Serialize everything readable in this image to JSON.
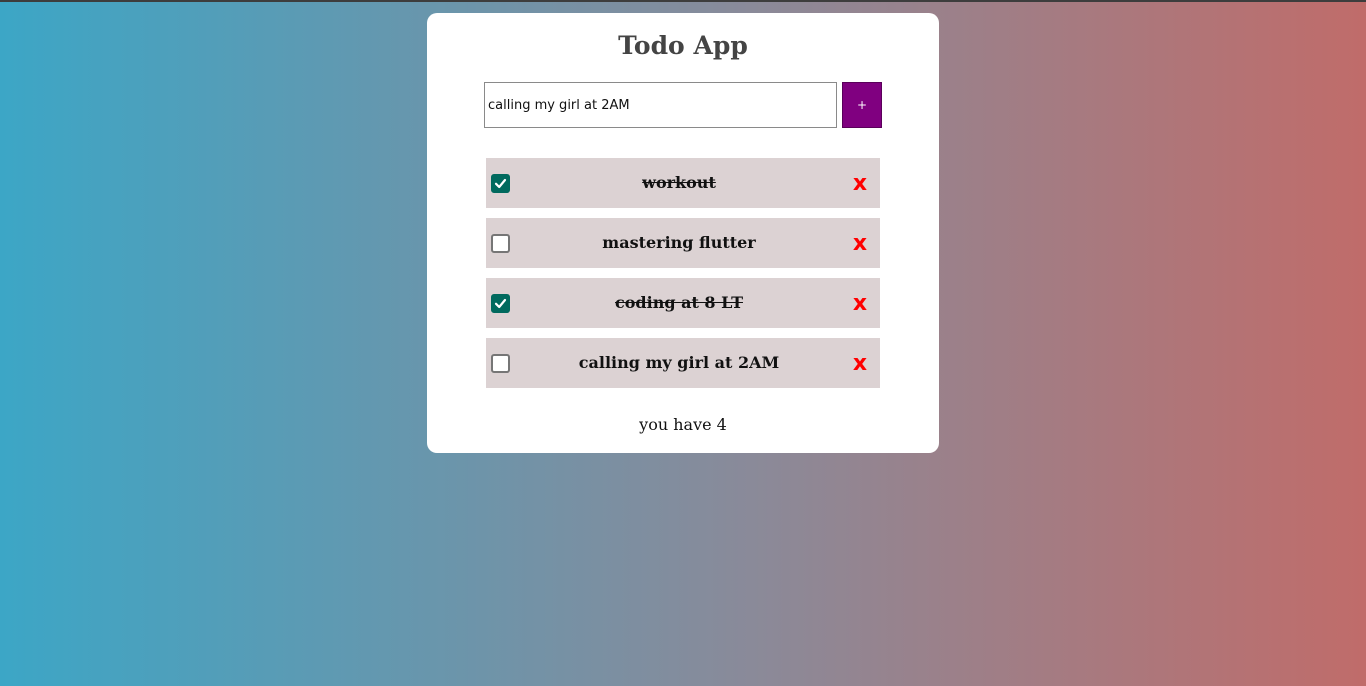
{
  "app": {
    "title": "Todo App"
  },
  "input": {
    "value": "calling my girl at 2AM",
    "placeholder": ""
  },
  "add_button": {
    "label": "+"
  },
  "todos": [
    {
      "text": "workout",
      "done": true
    },
    {
      "text": "mastering flutter",
      "done": false
    },
    {
      "text": "coding at 8 LT",
      "done": true
    },
    {
      "text": "calling my girl at 2AM",
      "done": false
    }
  ],
  "delete_label": "x",
  "footer": {
    "count_text": "you have 4"
  },
  "colors": {
    "gradient_left": "#3ca6c6",
    "gradient_right": "#c06c6a",
    "add_button": "#800080",
    "item_background": "#dcd2d3",
    "checkbox_checked": "#016a5e",
    "delete": "#ff0000"
  }
}
